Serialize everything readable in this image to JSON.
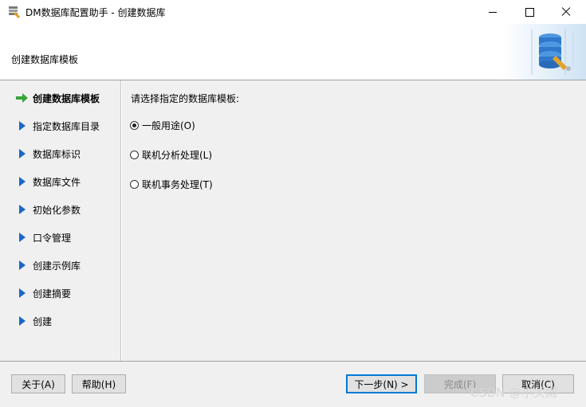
{
  "window": {
    "title": "DM数据库配置助手 - 创建数据库"
  },
  "header": {
    "title": "创建数据库模板"
  },
  "nav": {
    "items": [
      {
        "label": "创建数据库模板",
        "current": true
      },
      {
        "label": "指定数据库目录",
        "current": false
      },
      {
        "label": "数据库标识",
        "current": false
      },
      {
        "label": "数据库文件",
        "current": false
      },
      {
        "label": "初始化参数",
        "current": false
      },
      {
        "label": "口令管理",
        "current": false
      },
      {
        "label": "创建示例库",
        "current": false
      },
      {
        "label": "创建摘要",
        "current": false
      },
      {
        "label": "创建",
        "current": false
      }
    ]
  },
  "main": {
    "prompt": "请选择指定的数据库模板:",
    "options": [
      {
        "label": "一般用途(O)",
        "checked": true
      },
      {
        "label": "联机分析处理(L)",
        "checked": false
      },
      {
        "label": "联机事务处理(T)",
        "checked": false
      }
    ]
  },
  "footer": {
    "about": "关于(A)",
    "help": "帮助(H)",
    "next": "下一步(N) >",
    "finish": "完成(F)",
    "cancel": "取消(C)",
    "watermark": "CSDN @小关阔"
  },
  "colors": {
    "panel_bg": "#f0f0f0",
    "nav_arrow": "#1b67c9",
    "current_arrow": "#3aa43a",
    "default_button_border": "#0078d7"
  },
  "icons": {
    "app": "database-config-icon",
    "header": "database-stack-icon",
    "current": "green-arrow-icon",
    "step": "blue-triangle-icon"
  }
}
